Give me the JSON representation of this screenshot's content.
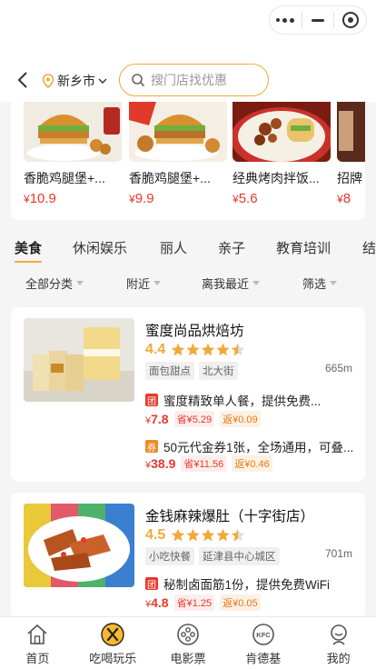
{
  "header": {
    "city": "新乡市",
    "search_placeholder": "搜门店找优惠"
  },
  "products": [
    {
      "name": "香脆鸡腿堡+...",
      "currency": "¥",
      "price": "10.9"
    },
    {
      "name": "香脆鸡腿堡+...",
      "currency": "¥",
      "price": "9.9"
    },
    {
      "name": "经典烤肉拌饭...",
      "currency": "¥",
      "price": "5.6"
    },
    {
      "name": "招牌",
      "currency": "¥",
      "price": "8"
    }
  ],
  "tabs": [
    "美食",
    "休闲娱乐",
    "丽人",
    "亲子",
    "教育培训",
    "结"
  ],
  "filters": [
    "全部分类",
    "附近",
    "离我最近",
    "筛选"
  ],
  "shops": [
    {
      "name": "蜜度尚品烘焙坊",
      "rating": "4.4",
      "tags": [
        "面包甜点",
        "北大街"
      ],
      "distance": "665m",
      "deals": [
        {
          "badge": "团",
          "desc": "蜜度精致单人餐，提供免费...",
          "price_currency": "¥",
          "price": "7.8",
          "save": "省¥5.29",
          "rebate": "返¥0.09"
        },
        {
          "badge": "券",
          "desc": "50元代金券1张，全场通用，可叠...",
          "price_currency": "¥",
          "price": "38.9",
          "save": "省¥11.56",
          "rebate": "返¥0.46"
        }
      ]
    },
    {
      "name": "金钱麻辣爆肚（十字街店）",
      "rating": "4.5",
      "tags": [
        "小吃快餐",
        "延津县中心城区"
      ],
      "distance": "701m",
      "deals": [
        {
          "badge": "团",
          "desc": "秘制卤面筋1份，提供免费WiFi",
          "price_currency": "¥",
          "price": "4.8",
          "save": "省¥1.25",
          "rebate": "返¥0.05"
        }
      ]
    }
  ],
  "bottom_nav": [
    {
      "label": "首页",
      "icon": "home-icon"
    },
    {
      "label": "吃喝玩乐",
      "icon": "fork-knife-icon"
    },
    {
      "label": "电影票",
      "icon": "film-reel-icon"
    },
    {
      "label": "肯德基",
      "icon": "kfc-icon"
    },
    {
      "label": "我的",
      "icon": "profile-icon"
    }
  ],
  "colors": {
    "accent": "#f2a93b",
    "price": "#e8382c",
    "group_badge": "#e8382c",
    "coupon_badge": "#f08a24"
  }
}
